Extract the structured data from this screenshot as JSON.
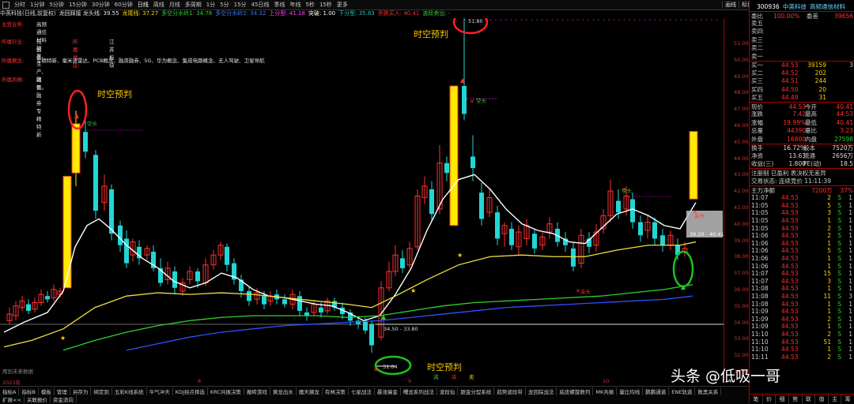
{
  "topbar": {
    "timeframes": [
      "分时",
      "1分钟",
      "5分钟",
      "15分钟",
      "30分钟",
      "60分钟",
      "日线",
      "周线",
      "月线",
      "多周期",
      "1分",
      "5分",
      "15分",
      "45日线",
      "季线",
      "年线",
      "5秒",
      "15秒",
      "更多"
    ],
    "selected": "日线",
    "tools": [
      "画线",
      "标记",
      "统计",
      "竖线",
      "叠加",
      "移动",
      "隐藏",
      "F10"
    ]
  },
  "infobar": {
    "items": [
      {
        "text": "中英科技(日线,前复权)",
        "color": "#dcdcdc"
      },
      {
        "text": "龙回踩接 龙头线: 39.55",
        "color": "#e6e6e6"
      },
      {
        "text": "龙尾线: 37.27",
        "color": "#ffd400"
      },
      {
        "text": "多空分水岭1: 34.78",
        "color": "#2fd12f"
      },
      {
        "text": "多空分水岭2: 34.32",
        "color": "#3a78ff"
      },
      {
        "text": "上分型: 41.18",
        "color": "#ff44ff"
      },
      {
        "text": "突破: 1.00",
        "color": "#ffffff"
      },
      {
        "text": "下分型: 35.83",
        "color": "#22c7c7"
      },
      {
        "text": "杀跌买入: 40.41",
        "color": "#ff3030"
      },
      {
        "text": "波段卖出: -",
        "color": "#2fd12f"
      }
    ]
  },
  "info_rows": [
    {
      "label": "主营业务:",
      "value": "高频通信材料研发、生产、销售。"
    },
    {
      "label": "所属行业:",
      "value": "元器件",
      "label2": "所属地区:",
      "value2": "江苏板块"
    },
    {
      "label": "所属概念:",
      "value": "专精特新、毫米波雷达、PCB概念、融资融券、5G、华为概念、集成电路概念、无人驾驶、卫星导航"
    },
    {
      "label": "所属风格:",
      "value": "融资融券 专精特新"
    }
  ],
  "annotations": {
    "ann1": "时空预判",
    "ann2": "时空预判",
    "ann3": "时空预判",
    "high_label": "51.80",
    "low_label": "31.04",
    "range_label": "34.50 - 33.80",
    "box_label": "39.20 - 40.41",
    "empty_hint": "用到未来数据",
    "year_label": "2023年",
    "month8": "8",
    "month9": "9",
    "month10": "10",
    "sig_jian": "减",
    "sig_sha": "杀",
    "sig_mai": "卖",
    "kongtou1": "空头",
    "kongtou2": "空头",
    "kongtou3": "空头",
    "shatou1": "杀头",
    "shatou2": "杀头"
  },
  "right_axis": {
    "ticks": [
      "51.00",
      "50.00",
      "49.00",
      "48.00",
      "47.00",
      "46.00",
      "45.00",
      "44.00",
      "43.00",
      "42.00",
      "41.00",
      "40.00",
      "39.00",
      "38.00",
      "37.00",
      "36.00",
      "35.00",
      "34.00",
      "33.00",
      "32.00",
      "31.00"
    ]
  },
  "panel": {
    "top_code": "300936",
    "top_name": "中英科技",
    "top_tag": "高频通信材料",
    "weibi_label": "委比",
    "weibi_val": "100.00%",
    "weicha_label": "委差",
    "weicha_val": "39656",
    "sells": [
      {
        "l": "卖五"
      },
      {
        "l": "卖四"
      },
      {
        "l": "卖三"
      },
      {
        "l": "卖二"
      },
      {
        "l": "卖一"
      }
    ],
    "buys": [
      {
        "l": "买一",
        "p": "44.53",
        "v": "39159",
        "c": "3"
      },
      {
        "l": "买二",
        "p": "44.52",
        "v": "202",
        "c": ""
      },
      {
        "l": "买三",
        "p": "44.51",
        "v": "244",
        "c": ""
      },
      {
        "l": "买四",
        "p": "44.50",
        "v": "20",
        "c": ""
      },
      {
        "l": "买五",
        "p": "44.49",
        "v": "31",
        "c": ""
      }
    ],
    "quote": [
      {
        "l1": "现价",
        "v1": "44.53",
        "l2": "今开",
        "v2": "40.41"
      },
      {
        "l1": "涨跌",
        "v1": "7.42",
        "l2": "最高",
        "v2": "44.53"
      },
      {
        "l1": "涨幅",
        "v1": "19.99%",
        "l2": "最低",
        "v2": "40.41"
      },
      {
        "l1": "总量",
        "v1": "44390",
        "l2": "量比",
        "v2": "3.23"
      },
      {
        "l1": "外盘",
        "v1": "16800",
        "l2": "内盘",
        "v2": "27598"
      }
    ],
    "fin": [
      {
        "l1": "换手",
        "v1": "16.72%",
        "l2": "股本",
        "v2": "7520万"
      },
      {
        "l1": "净资",
        "v1": "13.63",
        "l2": "流通",
        "v2": "2656万"
      },
      {
        "l1": "收益(三)",
        "v1": "1.800",
        "l2": "PE(动)",
        "v2": "18.5"
      }
    ],
    "reg": "注册制 已盈利 表决权无差异",
    "status": "交易状态: 连续竞价 11:11:39",
    "netflow_label": "主力净额",
    "netflow_val": "7200万",
    "netflow_pct": "37%",
    "ticks": [
      {
        "t": "11:07",
        "p": "44.53",
        "v": "2",
        "s": "S",
        "n": "1"
      },
      {
        "t": "11:05",
        "p": "44.53",
        "v": "5",
        "s": "S",
        "n": "1"
      },
      {
        "t": "11:05",
        "p": "44.53",
        "v": "3",
        "s": "S",
        "n": "1"
      },
      {
        "t": "11:05",
        "p": "44.53",
        "v": "1",
        "s": "S",
        "n": "1"
      },
      {
        "t": "11:05",
        "p": "44.53",
        "v": "2",
        "s": "S",
        "n": "1"
      },
      {
        "t": "11:06",
        "p": "44.53",
        "v": "2",
        "s": "S",
        "n": "1"
      },
      {
        "t": "11:06",
        "p": "44.53",
        "v": "1",
        "s": "S",
        "n": "1"
      },
      {
        "t": "11:06",
        "p": "44.53",
        "v": "5",
        "s": "S",
        "n": "1"
      },
      {
        "t": "11:06",
        "p": "44.53",
        "v": "1",
        "s": "S",
        "n": "1"
      },
      {
        "t": "11:06",
        "p": "44.53",
        "v": "1",
        "s": "S",
        "n": "1"
      },
      {
        "t": "11:07",
        "p": "44.53",
        "v": "15",
        "s": "S",
        "n": "1"
      },
      {
        "t": "11:07",
        "p": "44.53",
        "v": "3",
        "s": "S",
        "n": "1"
      },
      {
        "t": "11:08",
        "p": "44.53",
        "v": "1",
        "s": "S",
        "n": "1"
      },
      {
        "t": "11:08",
        "p": "44.53",
        "v": "11",
        "s": "S",
        "n": "3"
      },
      {
        "t": "11:08",
        "p": "44.53",
        "v": "1",
        "s": "S",
        "n": "1"
      },
      {
        "t": "11:09",
        "p": "44.53",
        "v": "1",
        "s": "S",
        "n": "1"
      },
      {
        "t": "11:09",
        "p": "44.53",
        "v": "2",
        "s": "S",
        "n": "1"
      },
      {
        "t": "11:09",
        "p": "44.53",
        "v": "1",
        "s": "S",
        "n": "1"
      },
      {
        "t": "11:10",
        "p": "44.53",
        "v": "2",
        "s": "S",
        "n": "1"
      },
      {
        "t": "11:10",
        "p": "44.53",
        "v": "51",
        "s": "S",
        "n": "1"
      },
      {
        "t": "11:10",
        "p": "44.53",
        "v": "1",
        "s": "S",
        "n": "1"
      },
      {
        "t": "11:11",
        "p": "44.53",
        "v": "2",
        "s": "S",
        "n": "1"
      }
    ],
    "bottom_tabs": [
      "笔",
      "价",
      "细",
      "势",
      "联",
      "值",
      "主",
      "筹"
    ]
  },
  "bottom": {
    "tabs": [
      "指标A",
      "指标B",
      "模板",
      "管理",
      "另存为",
      "绑定到",
      "五彩K线系统",
      "牛气冲天",
      "KDJ拐点择选",
      "KRC共振决策",
      "搬砖游戏",
      "黄龙出水",
      "魔天摘龙",
      "有林决策",
      "七星战法",
      "暴涨擒金",
      "曙龙系列战法",
      "波段仙",
      "跟金分型系统",
      "趋势波段带",
      "龙回踩战法",
      "底皮螺旋数列",
      "MK共振",
      "量比均线",
      "鹏鹏通道",
      "ENE轨道",
      "数黑关系"
    ],
    "tabs2": [
      "扩展<<",
      "关联报价",
      "资金流向"
    ]
  },
  "watermark": "头条 @低吸一哥",
  "colors": {
    "up": "#ff3030",
    "down": "#22d6d6",
    "yellow": "#ffea00",
    "white": "#ffffff",
    "ma2": "#f0e040",
    "ma3": "#2fd12f",
    "ma4": "#3050ff"
  }
}
